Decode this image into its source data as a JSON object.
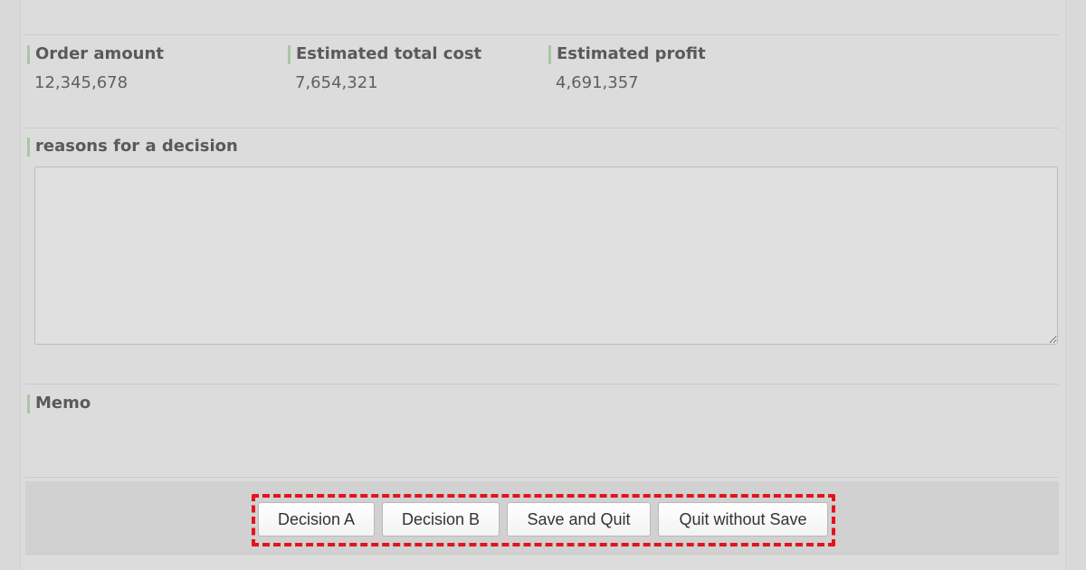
{
  "summary": {
    "order_amount": {
      "label": "Order amount",
      "value": "12,345,678"
    },
    "estimated_total_cost": {
      "label": "Estimated total cost",
      "value": "7,654,321"
    },
    "estimated_profit": {
      "label": "Estimated profit",
      "value": "4,691,357"
    }
  },
  "reasons": {
    "label": "reasons for a decision",
    "value": ""
  },
  "memo": {
    "label": "Memo"
  },
  "actions": {
    "decision_a": "Decision A",
    "decision_b": "Decision B",
    "save_and_quit": "Save and Quit",
    "quit_without_save": "Quit without Save"
  },
  "colors": {
    "label_accent": "#a9c7a4",
    "highlight_border": "#e2141c",
    "background": "#d9d9d9"
  }
}
